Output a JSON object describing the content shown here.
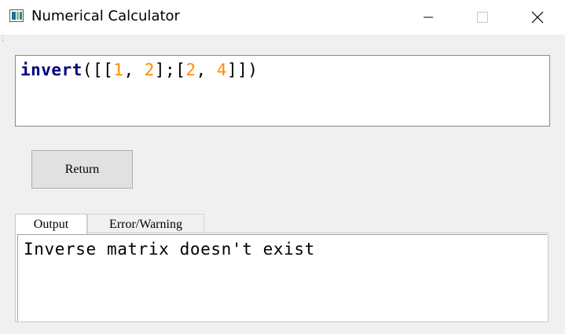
{
  "window": {
    "title": "Numerical Calculator",
    "controls": {
      "minimize": "minimize",
      "maximize": "maximize",
      "close": "close"
    }
  },
  "editor": {
    "tokens": [
      {
        "text": "invert",
        "kind": "keyword"
      },
      {
        "text": "([[",
        "kind": "plain"
      },
      {
        "text": "1",
        "kind": "number"
      },
      {
        "text": ", ",
        "kind": "plain"
      },
      {
        "text": "2",
        "kind": "number"
      },
      {
        "text": "];[",
        "kind": "plain"
      },
      {
        "text": "2",
        "kind": "number"
      },
      {
        "text": ", ",
        "kind": "plain"
      },
      {
        "text": "4",
        "kind": "number"
      },
      {
        "text": "]])",
        "kind": "plain"
      }
    ],
    "colors": {
      "keyword": "#000080",
      "number": "#ff8c00",
      "plain": "#000000"
    }
  },
  "actions": {
    "return_label": "Return"
  },
  "tabs": [
    {
      "label": "Output",
      "active": true
    },
    {
      "label": "Error/Warning",
      "active": false
    }
  ],
  "output": {
    "text": "Inverse matrix doesn't exist"
  }
}
